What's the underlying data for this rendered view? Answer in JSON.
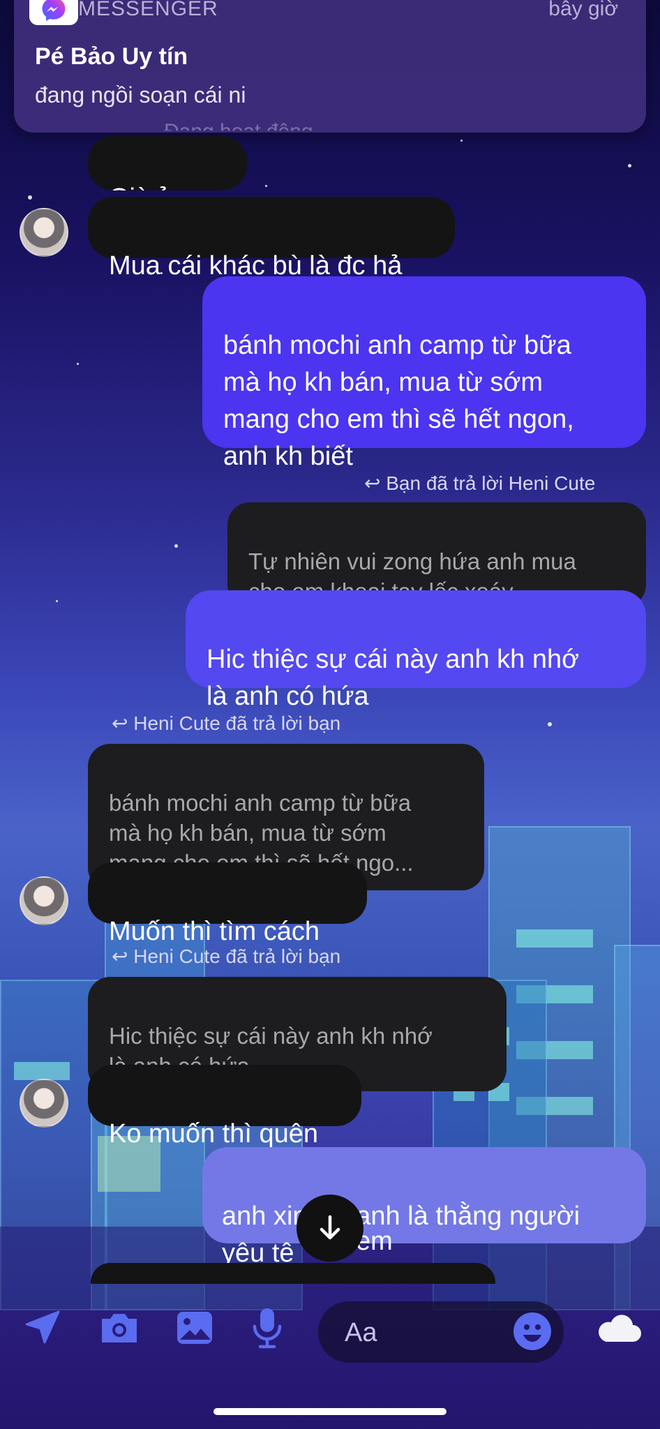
{
  "notification": {
    "app_name": "MESSENGER",
    "time": "bây giờ",
    "title": "Pé Bảo Uy tín",
    "body": "đang ngồi soạn cái ni"
  },
  "header": {
    "status_partial": "Đang hoạt động"
  },
  "messages": {
    "m1": "Giờ ỉm re",
    "m2": "Mua cái khác bù là đc hả",
    "m3": "bánh mochi anh camp từ bữa\nmà họ kh bán, mua từ sớm\nmang cho em thì sẽ hết ngon,\nanh kh biết",
    "reply1_label": "Bạn đã trả lời Heni Cute",
    "reply1_quote": "Tự nhiên vui zong hứa anh mua\ncho em khoai tay lốc xoáy",
    "m4": "Hic thiệc sự cái này anh kh nhớ\nlà anh có hứa",
    "reply2_label": "Heni Cute đã trả lời bạn",
    "reply2_quote": "bánh mochi anh camp từ bữa\nmà họ kh bán, mua từ sớm\nmang cho em thì sẽ hết ngo...",
    "m5": "Muốn thì tìm cách",
    "reply3_label": "Heni Cute đã trả lời bạn",
    "reply3_quote": "Hic thiệc sự cái này anh kh nhớ\nlà anh có hứa",
    "m6": "Ko muốn thì quên",
    "m7": "anh xin lỗi, anh là thằng người\nyêu tệ",
    "m7_tail": "em"
  },
  "composer": {
    "placeholder": "Aa"
  },
  "icons": [
    "send-location-icon",
    "camera-icon",
    "gallery-icon",
    "microphone-icon",
    "emoji-icon",
    "cloud-icon",
    "arrow-down-icon",
    "reply-arrow-icon",
    "messenger-logo-icon"
  ],
  "colors": {
    "sent": "#4b35f0",
    "sent_light": "#7378e6",
    "received": "#141414"
  }
}
